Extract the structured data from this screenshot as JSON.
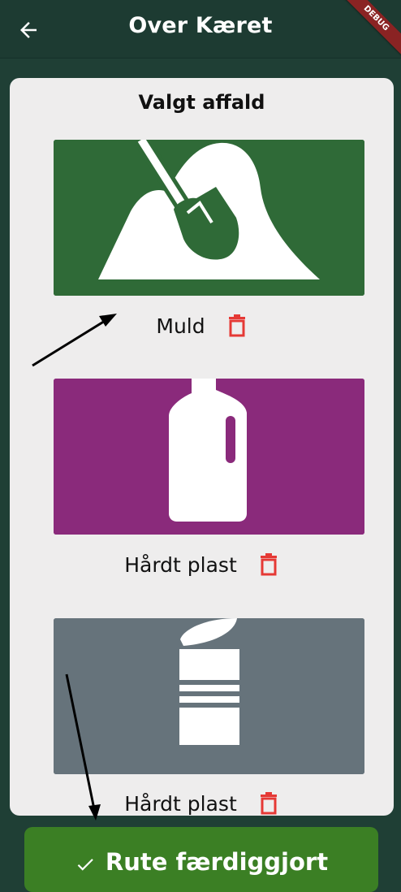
{
  "appbar": {
    "title": "Over Kæret",
    "back_icon": "arrow-left-icon",
    "debug_label": "DEBUG"
  },
  "card": {
    "title": "Valgt affald",
    "items": [
      {
        "label": "Muld",
        "color": "#2f6a37",
        "icon": "soil-shovel-icon"
      },
      {
        "label": "Hårdt plast",
        "color": "#8a2a7b",
        "icon": "plastic-bottle-icon"
      },
      {
        "label": "Hårdt plast",
        "color": "#66737b",
        "icon": "metal-can-icon"
      }
    ],
    "delete_icon": "trash-icon",
    "delete_color": "#e53935"
  },
  "footer": {
    "done_label": "Rute færdiggjort",
    "done_icon": "check-icon",
    "button_color": "#3b7f24"
  }
}
